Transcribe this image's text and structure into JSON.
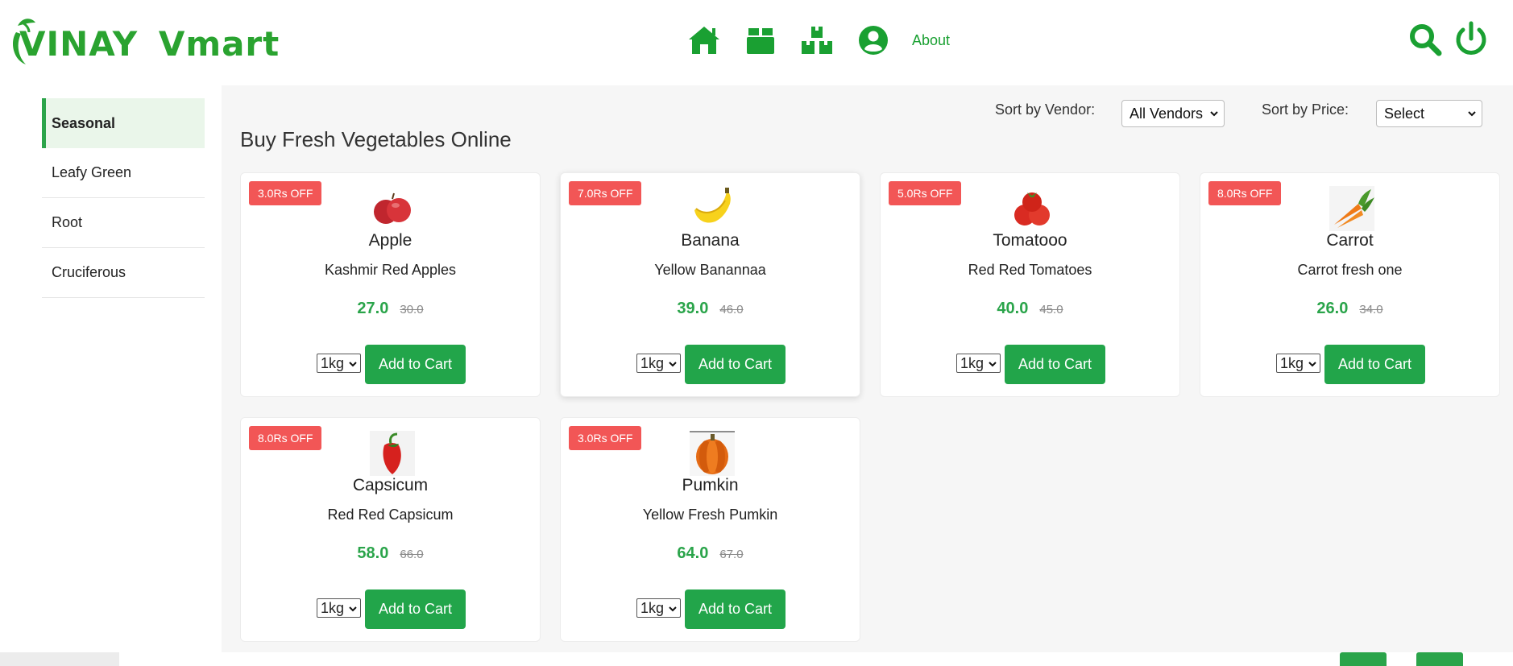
{
  "brand": {
    "logo_text_1": "VINAY",
    "logo_text_2": "Vmart",
    "color": "#2aa330"
  },
  "nav": {
    "items": [
      {
        "icon": "home-icon"
      },
      {
        "icon": "box-icon"
      },
      {
        "icon": "boxes-icon"
      },
      {
        "icon": "user-icon"
      }
    ],
    "about_label": "About",
    "accent": "#1aa032"
  },
  "header_actions": {
    "search_icon": "search-icon",
    "power_icon": "power-icon"
  },
  "sidebar": {
    "items": [
      {
        "label": "Seasonal",
        "active": true
      },
      {
        "label": "Leafy Green",
        "active": false
      },
      {
        "label": "Root",
        "active": false
      },
      {
        "label": "Cruciferous",
        "active": false
      }
    ]
  },
  "main": {
    "title": "Buy Fresh Vegetables Online",
    "sort_vendor_label": "Sort by Vendor:",
    "sort_vendor_value": "All Vendors",
    "sort_price_label": "Sort by Price:",
    "sort_price_value": "Select"
  },
  "products": [
    {
      "badge": "3.0Rs OFF",
      "name": "Apple",
      "desc": "Kashmir Red Apples",
      "price": "27.0",
      "old_price": "30.0",
      "qty": "1kg",
      "cta": "Add to Cart",
      "icon": "apple-image"
    },
    {
      "badge": "7.0Rs OFF",
      "name": "Banana",
      "desc": "Yellow Banannaa",
      "price": "39.0",
      "old_price": "46.0",
      "qty": "1kg",
      "cta": "Add to Cart",
      "icon": "banana-image"
    },
    {
      "badge": "5.0Rs OFF",
      "name": "Tomatooo",
      "desc": "Red Red Tomatoes",
      "price": "40.0",
      "old_price": "45.0",
      "qty": "1kg",
      "cta": "Add to Cart",
      "icon": "tomato-image"
    },
    {
      "badge": "8.0Rs OFF",
      "name": "Carrot",
      "desc": "Carrot fresh one",
      "price": "26.0",
      "old_price": "34.0",
      "qty": "1kg",
      "cta": "Add to Cart",
      "icon": "carrot-image"
    },
    {
      "badge": "8.0Rs OFF",
      "name": "Capsicum",
      "desc": "Red Red Capsicum",
      "price": "58.0",
      "old_price": "66.0",
      "qty": "1kg",
      "cta": "Add to Cart",
      "icon": "capsicum-image"
    },
    {
      "badge": "3.0Rs OFF",
      "name": "Pumkin",
      "desc": "Yellow Fresh Pumkin",
      "price": "64.0",
      "old_price": "67.0",
      "qty": "1kg",
      "cta": "Add to Cart",
      "icon": "pumpkin-image"
    }
  ],
  "colors": {
    "badge": "#f25656",
    "button": "#22a54a",
    "price": "#2aa44a",
    "panel": "#f6f6f6"
  }
}
